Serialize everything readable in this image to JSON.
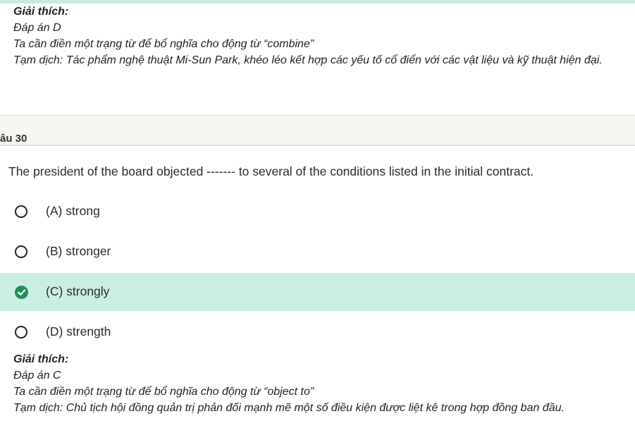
{
  "previous_explanation": {
    "title": "Giải thích:",
    "answer": "Đáp án D",
    "reason": "Ta cần điền một trạng từ để bổ nghĩa cho động từ “combine”",
    "translation": "Tạm dịch: Tác phẩm nghệ thuật Mi-Sun Park, khéo léo kết hợp các yếu tố cổ điển với các vật liệu và kỹ thuật hiện đại."
  },
  "question": {
    "number_label": "âu 30",
    "text": "The president of the board objected ------- to several of the conditions listed in the initial contract.",
    "options": [
      {
        "label": "(A) strong",
        "selected": false
      },
      {
        "label": "(B) stronger",
        "selected": false
      },
      {
        "label": "(C) strongly",
        "selected": true
      },
      {
        "label": "(D) strength",
        "selected": false
      }
    ]
  },
  "explanation": {
    "title": "Giải thích:",
    "answer": "Đáp án C",
    "reason": "Ta cần điền một trạng từ để bổ nghĩa cho động từ “object to”",
    "translation": "Tạm dịch: Chủ tịch hội đồng quản trị phản đối mạnh mẽ một số điều kiện được liệt kê trong hợp đồng ban đầu."
  },
  "colors": {
    "selected_background": "#cbeee2",
    "check_green": "#1e8f5a",
    "header_background": "#f6f5f0"
  }
}
